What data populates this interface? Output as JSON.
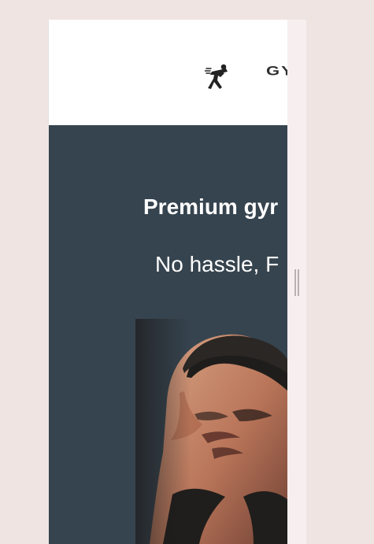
{
  "header": {
    "logo_icon": "boxer-icon",
    "logo_text": "GY"
  },
  "hero": {
    "title": "Premium gyr",
    "subtitle": "No hassle, F",
    "image": "athlete-portrait"
  },
  "scrollbar": {
    "orientation": "vertical"
  },
  "colors": {
    "page_background": "#efe4e2",
    "header_background": "#ffffff",
    "hero_background": "#36444f",
    "hero_text": "#ffffff",
    "scroll_rail": "#f7efef"
  }
}
